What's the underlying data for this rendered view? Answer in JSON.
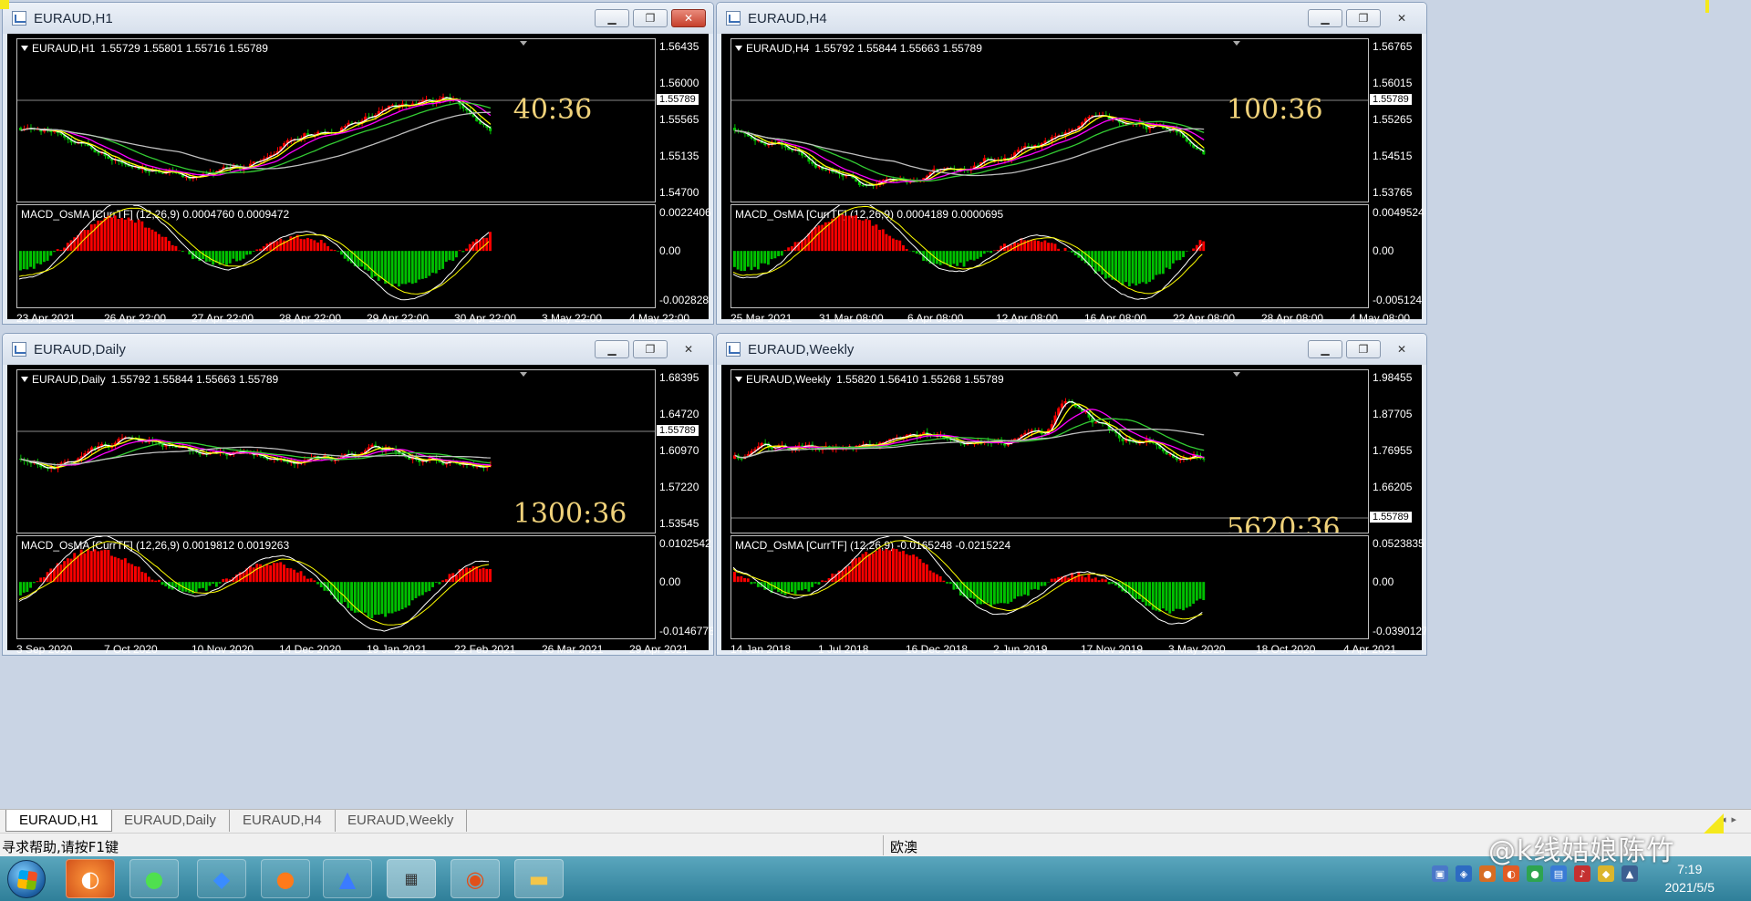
{
  "colors": {
    "bull": "#ff0000",
    "bear": "#00c000",
    "ma_white": "#ffffff",
    "ma_yellow": "#ffff00",
    "ma_magenta": "#ff00ff",
    "ma_green": "#33cc33",
    "ma_gray": "#bfbfbf",
    "timer": "#f0d27a"
  },
  "windows": [
    {
      "title": "EURAUD,H1",
      "symbol_label": "EURAUD,H1",
      "ohlc": "1.55729 1.55801 1.55716 1.55789",
      "price_ticks": [
        "1.56435",
        "1.56000",
        "1.55565",
        "1.55135",
        "1.54700"
      ],
      "current_price": "1.55789",
      "timer": "40:36",
      "macd_label": "MACD_OsMA [CurrTF] (12,26,9) 0.0004760 0.0009472",
      "macd_ticks": [
        "0.0022406",
        "0.00",
        "-0.002828"
      ],
      "time_ticks": [
        "23 Apr 2021",
        "26 Apr 22:00",
        "27 Apr 22:00",
        "28 Apr 22:00",
        "29 Apr 22:00",
        "30 Apr 22:00",
        "3 May 22:00",
        "4 May 22:00"
      ],
      "close_style": "red",
      "seed": 11
    },
    {
      "title": "EURAUD,H4",
      "symbol_label": "EURAUD,H4",
      "ohlc": "1.55792 1.55844 1.55663 1.55789",
      "price_ticks": [
        "1.56765",
        "1.56015",
        "1.55265",
        "1.54515",
        "1.53765"
      ],
      "current_price": "1.55789",
      "timer": "100:36",
      "macd_label": "MACD_OsMA [CurrTF] (12,26,9) 0.0004189 0.0000695",
      "macd_ticks": [
        "0.0049524",
        "0.00",
        "-0.005124"
      ],
      "time_ticks": [
        "25 Mar 2021",
        "31 Mar 08:00",
        "6 Apr 08:00",
        "12 Apr 08:00",
        "16 Apr 08:00",
        "22 Apr 08:00",
        "28 Apr 08:00",
        "4 May 08:00"
      ],
      "close_style": "plain",
      "seed": 23
    },
    {
      "title": "EURAUD,Daily",
      "symbol_label": "EURAUD,Daily",
      "ohlc": "1.55792 1.55844 1.55663 1.55789",
      "price_ticks": [
        "1.68395",
        "1.64720",
        "1.60970",
        "1.57220",
        "1.53545"
      ],
      "current_price": "1.55789",
      "timer": "1300:36",
      "macd_label": "MACD_OsMA [CurrTF] (12,26,9) 0.0019812 0.0019263",
      "macd_ticks": [
        "0.0102542",
        "0.00",
        "-0.0146778"
      ],
      "time_ticks": [
        "3 Sep 2020",
        "7 Oct 2020",
        "10 Nov 2020",
        "14 Dec 2020",
        "19 Jan 2021",
        "22 Feb 2021",
        "26 Mar 2021",
        "29 Apr 2021"
      ],
      "close_style": "plain",
      "seed": 37
    },
    {
      "title": "EURAUD,Weekly",
      "symbol_label": "EURAUD,Weekly",
      "ohlc": "1.55820 1.56410 1.55268 1.55789",
      "price_ticks": [
        "1.98455",
        "1.87705",
        "1.76955",
        "1.66205",
        "1.55789"
      ],
      "current_price": "1.55789",
      "timer": "5620:36",
      "macd_label": "MACD_OsMA [CurrTF] (12,26,9) -0.0165248 -0.0215224",
      "macd_ticks": [
        "0.0523835",
        "0.00",
        "-0.0390127"
      ],
      "time_ticks": [
        "14 Jan 2018",
        "1 Jul 2018",
        "16 Dec 2018",
        "2 Jun 2019",
        "17 Nov 2019",
        "3 May 2020",
        "18 Oct 2020",
        "4 Apr 2021"
      ],
      "close_style": "plain",
      "seed": 53
    }
  ],
  "tabs": [
    "EURAUD,H1",
    "EURAUD,Daily",
    "EURAUD,H4",
    "EURAUD,Weekly"
  ],
  "status": {
    "help": "寻求帮助,请按F1键",
    "market": "欧澳"
  },
  "clock": {
    "time": "7:19",
    "date": "2021/5/5"
  },
  "watermark": "@k线姑娘陈竹",
  "taskbar_apps": [
    "start-menu",
    "browser-orange",
    "wechat",
    "feather-app",
    "firefox",
    "lark",
    "trading-app",
    "game-app",
    "file-explorer"
  ]
}
